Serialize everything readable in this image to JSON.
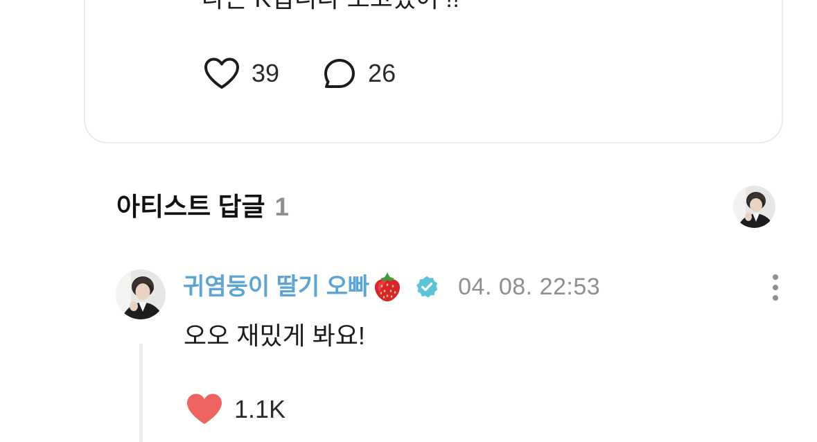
{
  "post": {
    "text": "나는 K입니다 보고있어 !!",
    "like_count": "39",
    "comment_count": "26"
  },
  "artist_replies": {
    "title": "아티스트 답글",
    "count": "1"
  },
  "reply": {
    "author": "귀염둥이 딸기 오빠",
    "author_emoji_icon": "strawberry-icon",
    "verified_icon": "verified-badge-icon",
    "timestamp": "04. 08. 22:53",
    "text": "오오 재밌게 봐요!",
    "like_count": "1.1K",
    "liked": true
  },
  "colors": {
    "author_name": "#5aa4d6",
    "verified_badge": "#5cc3d9",
    "liked_heart": "#ef6461",
    "muted_text": "#8e8e93",
    "card_border": "#e9eaee"
  }
}
